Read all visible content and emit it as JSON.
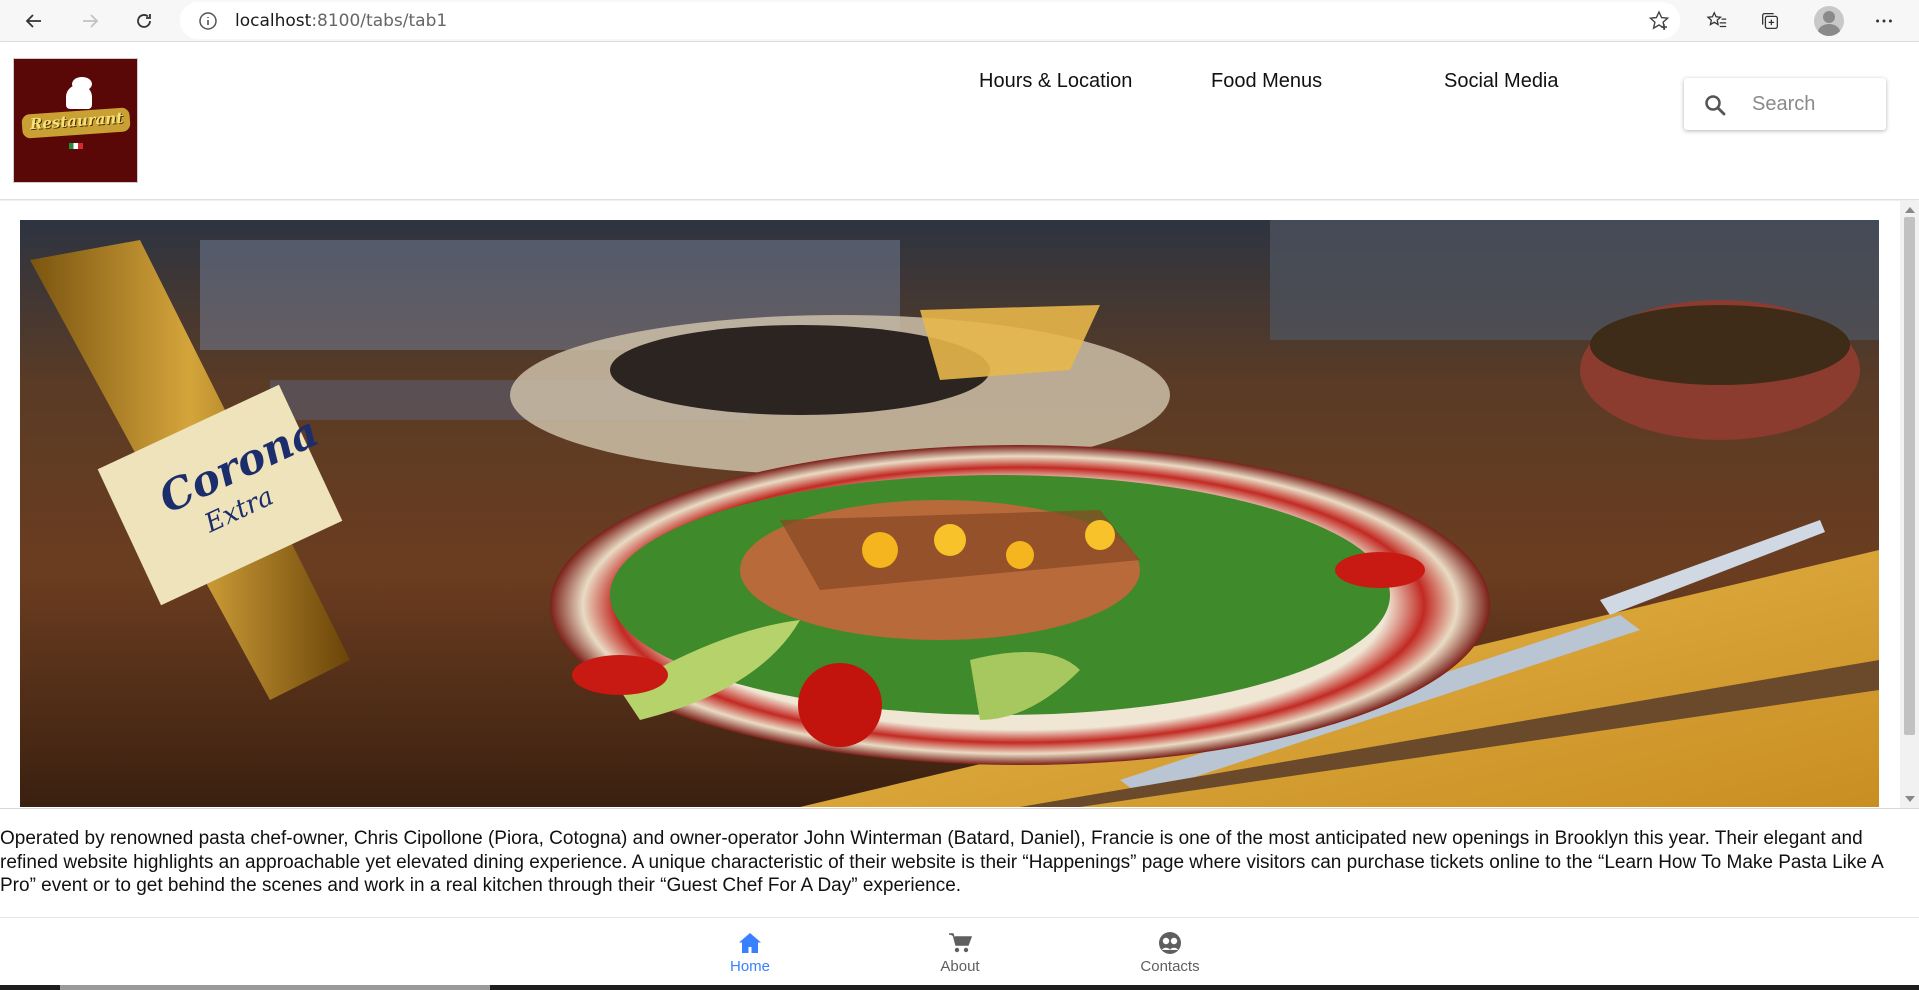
{
  "browser": {
    "url_host": "localhost",
    "url_rest": ":8100/tabs/tab1"
  },
  "header": {
    "logo_text": "Restaurant",
    "nav": [
      {
        "label": "Hours & Location"
      },
      {
        "label": "Food Menus"
      },
      {
        "label": "Social Media"
      }
    ],
    "search_placeholder": "Search"
  },
  "main": {
    "hero_alt": "Restaurant dish",
    "description": "Operated by renowned pasta chef-owner, Chris Cipollone (Piora, Cotogna) and owner-operator John Winterman (Batard, Daniel), Francie is one of the most anticipated new openings in Brooklyn this year. Their elegant and refined website highlights an approachable yet elevated dining experience. A unique characteristic of their website is their “Happenings” page where visitors can purchase tickets online to the “Learn How To Make Pasta Like A Pro” event or to get behind the scenes and work in a real kitchen through their “Guest Chef For A Day” experience."
  },
  "tabs": [
    {
      "label": "Home",
      "icon": "home-icon",
      "active": true
    },
    {
      "label": "About",
      "icon": "cart-icon",
      "active": false
    },
    {
      "label": "Contacts",
      "icon": "people-icon",
      "active": false
    }
  ],
  "colors": {
    "accent": "#3880ff",
    "logo_bg": "#5a0707"
  }
}
